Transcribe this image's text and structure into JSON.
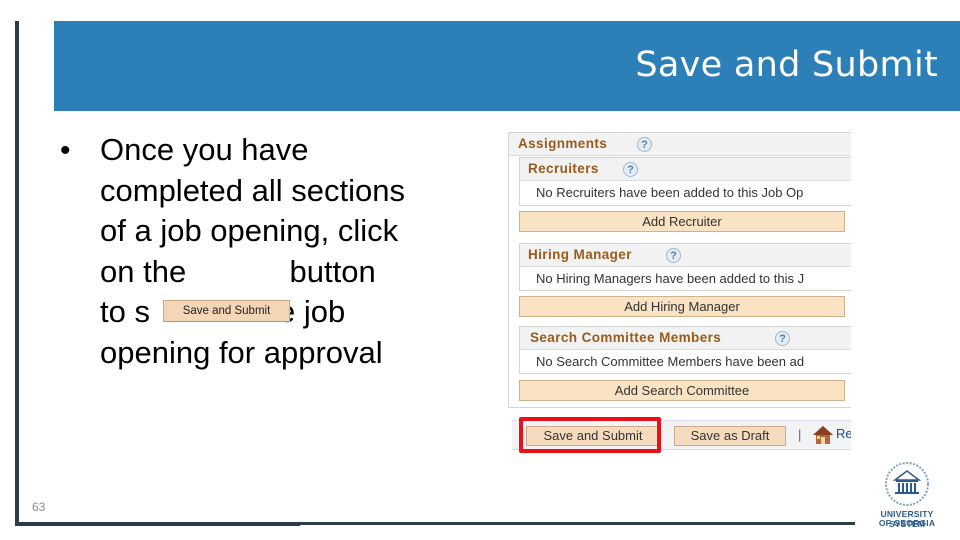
{
  "header": {
    "title": "Save and Submit"
  },
  "bullet": {
    "lines": [
      "Once you have",
      "completed all sections",
      "of a job opening, click",
      "on the            button",
      "to s",
      "opening for approval"
    ],
    "line5_tail": "e job",
    "inline_button_label": "Save and Submit"
  },
  "screenshot": {
    "assignments": {
      "title": "Assignments",
      "help": "?"
    },
    "recruiters": {
      "title": "Recruiters",
      "help": "?",
      "empty": "No Recruiters have been added to this Job Op",
      "button": "Add Recruiter"
    },
    "hiring_manager": {
      "title": "Hiring Manager",
      "help": "?",
      "empty": "No Hiring Managers have been added to this J",
      "button": "Add Hiring Manager"
    },
    "search_committee": {
      "title": "Search Committee Members",
      "help": "?",
      "empty": "No Search Committee Members have been ad",
      "button": "Add Search Committee"
    },
    "footer": {
      "save_submit": "Save and Submit",
      "save_draft": "Save as Draft",
      "separator": "|",
      "return_link": "Re"
    }
  },
  "highlight_color": "#e8101a",
  "accent_color": "#2d7fb8",
  "page_number": "63",
  "logo": {
    "line1": "UNIVERSITY SYSTEM",
    "line2": "OF GEORGIA"
  }
}
